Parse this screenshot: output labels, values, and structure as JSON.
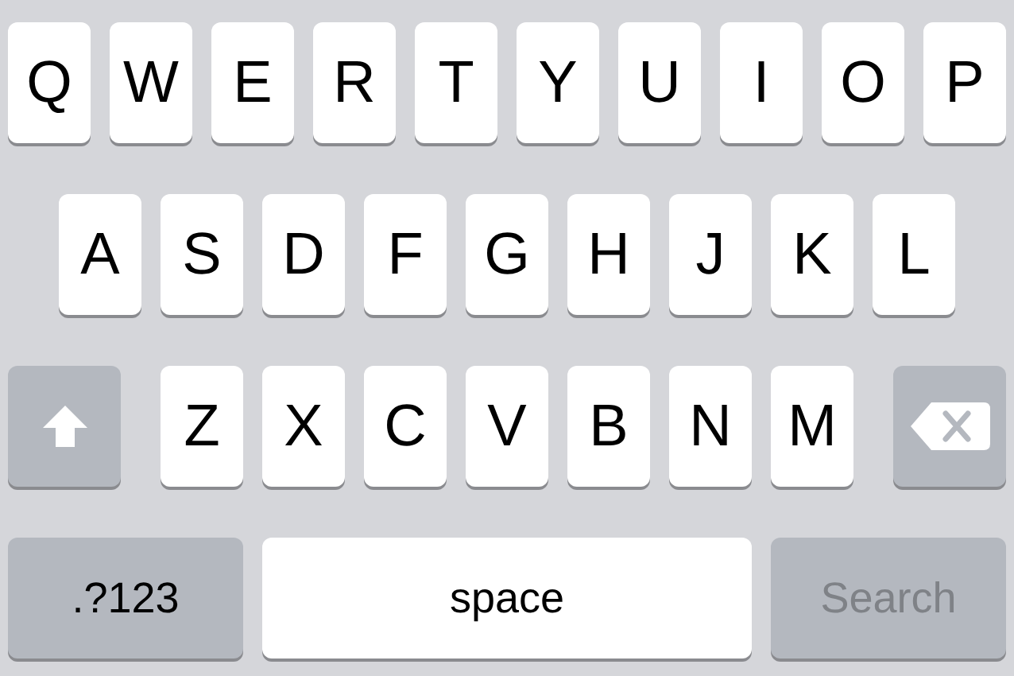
{
  "keyboard": {
    "rows": [
      {
        "keys": [
          {
            "kind": "letter",
            "label": "Q"
          },
          {
            "kind": "letter",
            "label": "W"
          },
          {
            "kind": "letter",
            "label": "E"
          },
          {
            "kind": "letter",
            "label": "R"
          },
          {
            "kind": "letter",
            "label": "T"
          },
          {
            "kind": "letter",
            "label": "Y"
          },
          {
            "kind": "letter",
            "label": "U"
          },
          {
            "kind": "letter",
            "label": "I"
          },
          {
            "kind": "letter",
            "label": "O"
          },
          {
            "kind": "letter",
            "label": "P"
          }
        ]
      },
      {
        "keys": [
          {
            "kind": "letter",
            "label": "A"
          },
          {
            "kind": "letter",
            "label": "S"
          },
          {
            "kind": "letter",
            "label": "D"
          },
          {
            "kind": "letter",
            "label": "F"
          },
          {
            "kind": "letter",
            "label": "G"
          },
          {
            "kind": "letter",
            "label": "H"
          },
          {
            "kind": "letter",
            "label": "J"
          },
          {
            "kind": "letter",
            "label": "K"
          },
          {
            "kind": "letter",
            "label": "L"
          }
        ]
      },
      {
        "keys": [
          {
            "kind": "shift"
          },
          {
            "kind": "letter",
            "label": "Z"
          },
          {
            "kind": "letter",
            "label": "X"
          },
          {
            "kind": "letter",
            "label": "C"
          },
          {
            "kind": "letter",
            "label": "V"
          },
          {
            "kind": "letter",
            "label": "B"
          },
          {
            "kind": "letter",
            "label": "N"
          },
          {
            "kind": "letter",
            "label": "M"
          },
          {
            "kind": "delete"
          }
        ]
      },
      {
        "keys": [
          {
            "kind": "mode",
            "label": ".?123"
          },
          {
            "kind": "space",
            "label": "space"
          },
          {
            "kind": "action",
            "label": "Search",
            "disabled": true
          }
        ]
      }
    ]
  }
}
